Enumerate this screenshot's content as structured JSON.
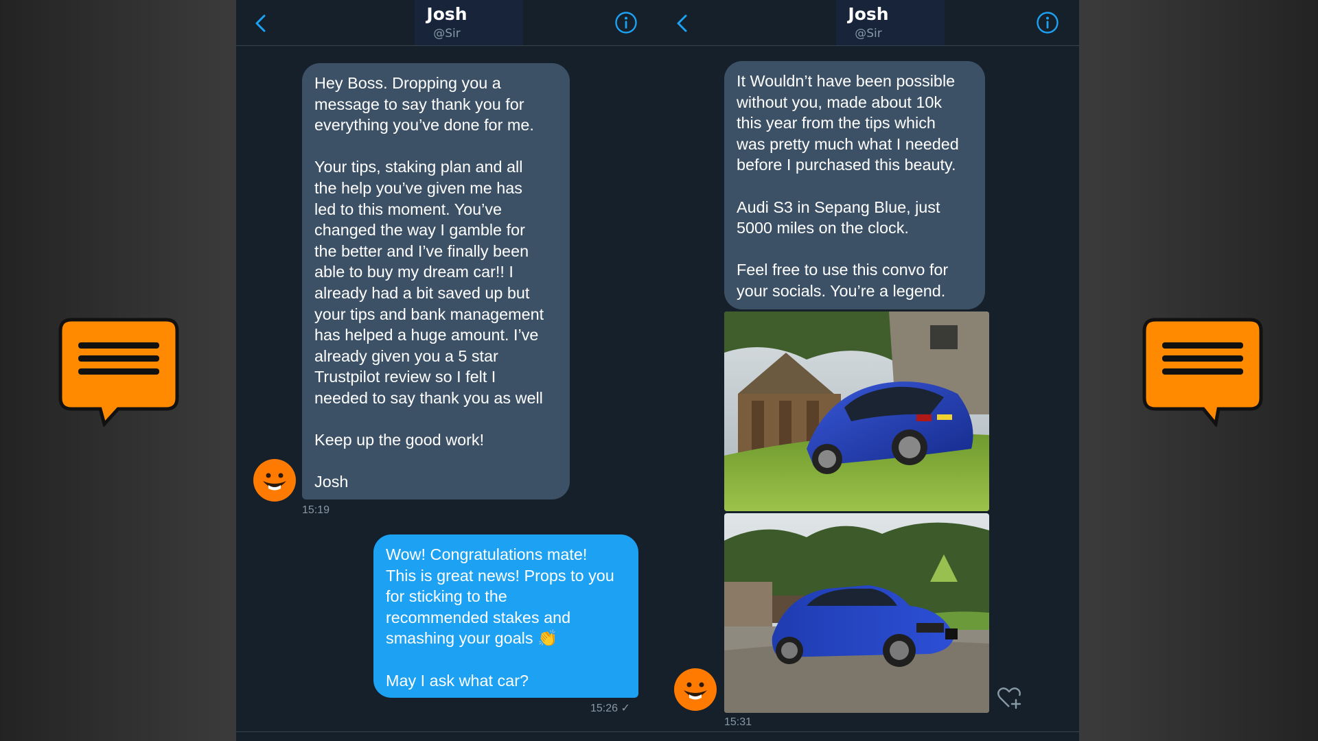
{
  "left_panel": {
    "header": {
      "name": "Josh",
      "handle": "@Sir",
      "back_icon": "chevron-left-icon",
      "info_icon": "info-icon"
    },
    "messages": [
      {
        "direction": "incoming",
        "text": "Hey Boss. Dropping you a\nmessage to say thank you for\neverything you’ve done for me.\n\nYour tips, staking plan and all\nthe help you’ve given me has\nled to this moment. You’ve\nchanged the way I gamble for\nthe better and I’ve finally been\nable to buy my dream car!! I\nalready had a bit saved up but\nyour tips and bank management\nhas helped a huge amount. I’ve\nalready given you a 5 star\nTrustpilot review so I felt I\nneeded to say thank you as well\n\nKeep up the good work!\n\nJosh",
        "time": "15:19"
      },
      {
        "direction": "outgoing",
        "text": "Wow! Congratulations mate!\nThis is great news! Props to you\nfor sticking to the\nrecommended stakes and\nsmashing your goals 👏\n\nMay I ask what car?",
        "time": "15:26 ✓"
      }
    ]
  },
  "right_panel": {
    "header": {
      "name": "Josh",
      "handle": "@Sir",
      "back_icon": "chevron-left-icon",
      "info_icon": "info-icon"
    },
    "messages": [
      {
        "direction": "incoming",
        "text": "It Wouldn’t have been possible\nwithout you, made about 10k\nthis year from the tips which\nwas pretty much what I needed\nbefore I purchased this beauty.\n\nAudi S3 in Sepang Blue, just\n5000 miles on the clock.\n\nFeel free to use this convo for\nyour socials. You’re a legend."
      }
    ],
    "photos": [
      "car-photo-rear",
      "car-photo-front"
    ],
    "time": "15:31",
    "like_icon": "heart-plus-icon"
  },
  "decoration_icons": [
    "chat-bubble-icon",
    "chat-bubble-icon"
  ],
  "colors": {
    "panel_bg": "#15202b",
    "incoming_bubble": "#3d5166",
    "outgoing_bubble": "#1da1f2",
    "accent": "#1da1f2",
    "avatar": "#ff7a00",
    "deco_orange": "#ff8a00"
  }
}
